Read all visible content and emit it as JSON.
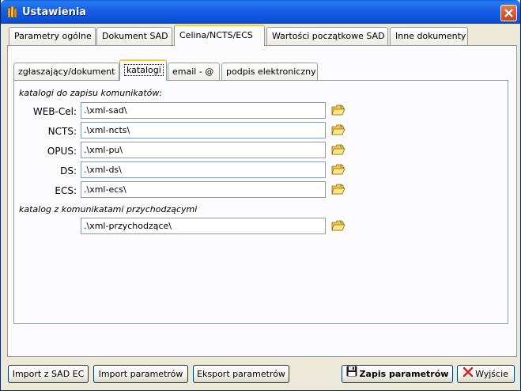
{
  "window": {
    "title": "Ustawienia"
  },
  "tabs": [
    {
      "label": "Parametry ogólne"
    },
    {
      "label": "Dokument SAD"
    },
    {
      "label": "Celina/NCTS/ECS",
      "active": true
    },
    {
      "label": "Wartości początkowe SAD"
    },
    {
      "label": "Inne dokumenty"
    }
  ],
  "subtabs": [
    {
      "label": "zgłaszający/dokument"
    },
    {
      "label": "katalogi",
      "active": true
    },
    {
      "label": "email - @"
    },
    {
      "label": "podpis elektroniczny"
    }
  ],
  "catalogs": {
    "outgoing_header": "katalogi do zapisu komunikatów:",
    "fields": [
      {
        "label": "WEB-Cel:",
        "value": ".\\xml-sad\\"
      },
      {
        "label": "NCTS:",
        "value": ".\\xml-ncts\\"
      },
      {
        "label": "OPUS:",
        "value": ".\\xml-pu\\"
      },
      {
        "label": "DS:",
        "value": ".\\xml-ds\\"
      },
      {
        "label": "ECS:",
        "value": ".\\xml-ecs\\"
      }
    ],
    "incoming_header": "katalog z komunikatami przychodzącymi",
    "incoming_value": ".\\xml-przychodzące\\"
  },
  "buttons": {
    "import_sad": "Import z SAD EC",
    "import_params": "Import parametrów",
    "export_params": "Eksport parametrów",
    "save": "Zapis parametrów",
    "exit": "Wyjście"
  },
  "icons": {
    "app": "gear-icon",
    "close": "close-icon",
    "folder": "folder-open-icon",
    "save": "floppy-disk-icon",
    "exit": "red-x-icon"
  },
  "colors": {
    "titlebar": "#0b4fd8",
    "active_tab_highlight": "#ffc83c",
    "window_bg": "#ece9d8"
  }
}
